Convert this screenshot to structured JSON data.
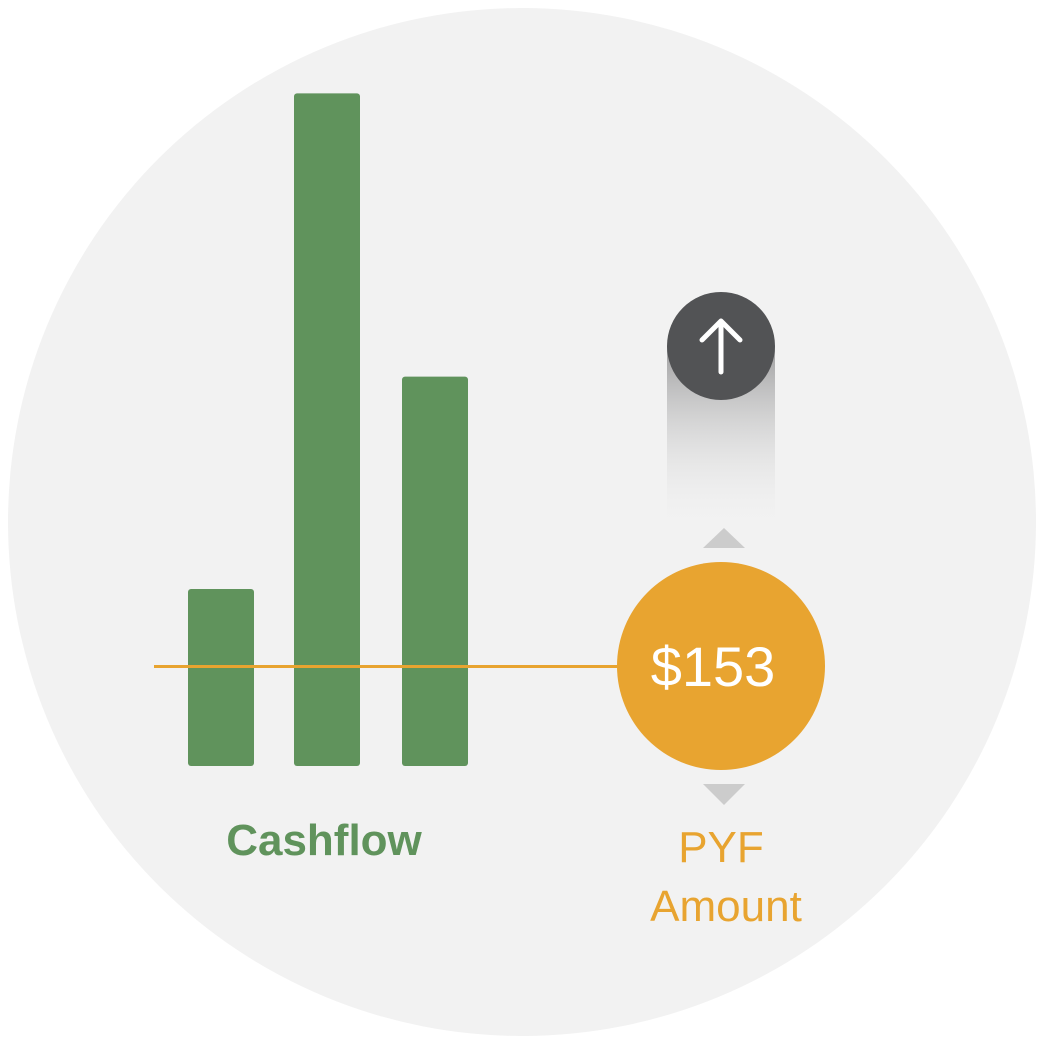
{
  "colors": {
    "background_circle": "#f2f2f2",
    "cashflow_green": "#60935c",
    "pyf_orange": "#e8a430",
    "arrow_button": "#525355",
    "triangle_gray": "#cccccc",
    "white": "#ffffff"
  },
  "cashflow": {
    "label": "Cashflow",
    "bars": [
      {
        "name": "bar-1",
        "value": 1.0
      },
      {
        "name": "bar-2",
        "value": 3.8
      },
      {
        "name": "bar-3",
        "value": 2.2
      }
    ],
    "baseline_value": 0.5
  },
  "pyf": {
    "amount_text": "$153",
    "label_line1": "PYF",
    "label_line2": "Amount"
  },
  "icons": {
    "increase": "arrow-up-icon",
    "up_indicator": "triangle-up-icon",
    "down_indicator": "triangle-down-icon"
  }
}
